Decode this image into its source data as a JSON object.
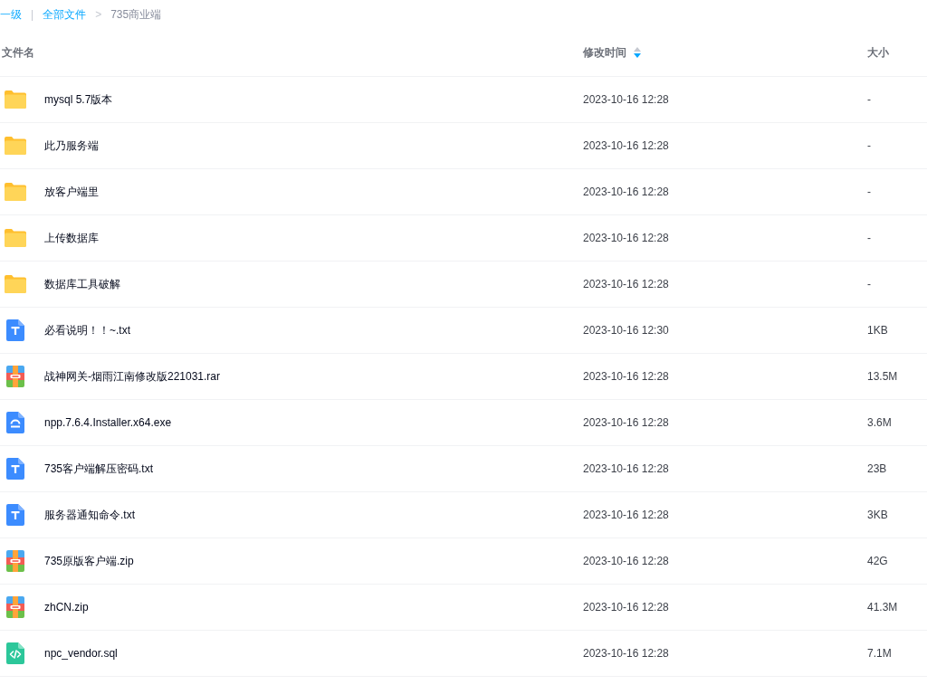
{
  "breadcrumb": [
    {
      "kind": "link",
      "label": "一级"
    },
    {
      "kind": "separator",
      "label": "|"
    },
    {
      "kind": "link",
      "label": "全部文件"
    },
    {
      "kind": "separator",
      "label": ">"
    },
    {
      "kind": "current",
      "label": "735商业端"
    }
  ],
  "table": {
    "columns": [
      {
        "label": "文件名"
      },
      {
        "label": "修改时间",
        "sortable": true,
        "sort_descending": true
      },
      {
        "label": "大小"
      }
    ],
    "rows": [
      {
        "kind": "folder",
        "name": "mysql 5.7版本",
        "modified": "2023-10-16 12:28",
        "size": "-"
      },
      {
        "kind": "folder",
        "name": "此乃服务端",
        "modified": "2023-10-16 12:28",
        "size": "-"
      },
      {
        "kind": "folder",
        "name": "放客户端里",
        "modified": "2023-10-16 12:28",
        "size": "-"
      },
      {
        "kind": "folder",
        "name": "上传数据库",
        "modified": "2023-10-16 12:28",
        "size": "-"
      },
      {
        "kind": "folder",
        "name": "数据库工具破解",
        "modified": "2023-10-16 12:28",
        "size": "-"
      },
      {
        "kind": "text",
        "name": "必看说明！！~.txt",
        "modified": "2023-10-16 12:30",
        "size": "1KB"
      },
      {
        "kind": "archive",
        "name": "战神网关-烟雨江南修改版221031.rar",
        "modified": "2023-10-16 12:28",
        "size": "13.5M"
      },
      {
        "kind": "installer",
        "name": "npp.7.6.4.Installer.x64.exe",
        "modified": "2023-10-16 12:28",
        "size": "3.6M"
      },
      {
        "kind": "text",
        "name": "735客户端解压密码.txt",
        "modified": "2023-10-16 12:28",
        "size": "23B"
      },
      {
        "kind": "text",
        "name": "服务器通知命令.txt",
        "modified": "2023-10-16 12:28",
        "size": "3KB"
      },
      {
        "kind": "archive",
        "name": "735原版客户端.zip",
        "modified": "2023-10-16 12:28",
        "size": "42G"
      },
      {
        "kind": "archive",
        "name": "zhCN.zip",
        "modified": "2023-10-16 12:28",
        "size": "41.3M"
      },
      {
        "kind": "code",
        "name": "npc_vendor.sql",
        "modified": "2023-10-16 12:28",
        "size": "7.1M"
      }
    ]
  }
}
